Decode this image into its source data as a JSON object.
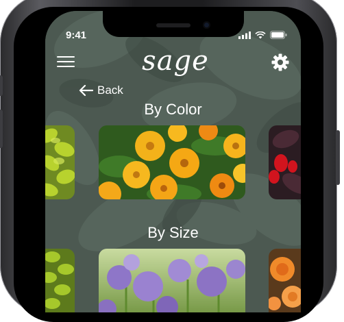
{
  "status": {
    "time": "9:41"
  },
  "app": {
    "logo_text": "sage",
    "back_label": "Back"
  },
  "sections": [
    {
      "title": "By Color",
      "cards": [
        "green-foliage-plant",
        "orange-calendula-flowers",
        "red-dark-foliage-plant"
      ]
    },
    {
      "title": "By Size",
      "cards": [
        "lime-foliage-plant",
        "purple-allium-flowers",
        "orange-rose-flowers"
      ]
    }
  ],
  "colors": {
    "background": "#4d5a52",
    "accent": "#ffffff",
    "frame": "#1d1d1f"
  },
  "icons": {
    "menu": "hamburger-menu-icon",
    "settings": "gear-icon",
    "back": "arrow-left-icon"
  }
}
